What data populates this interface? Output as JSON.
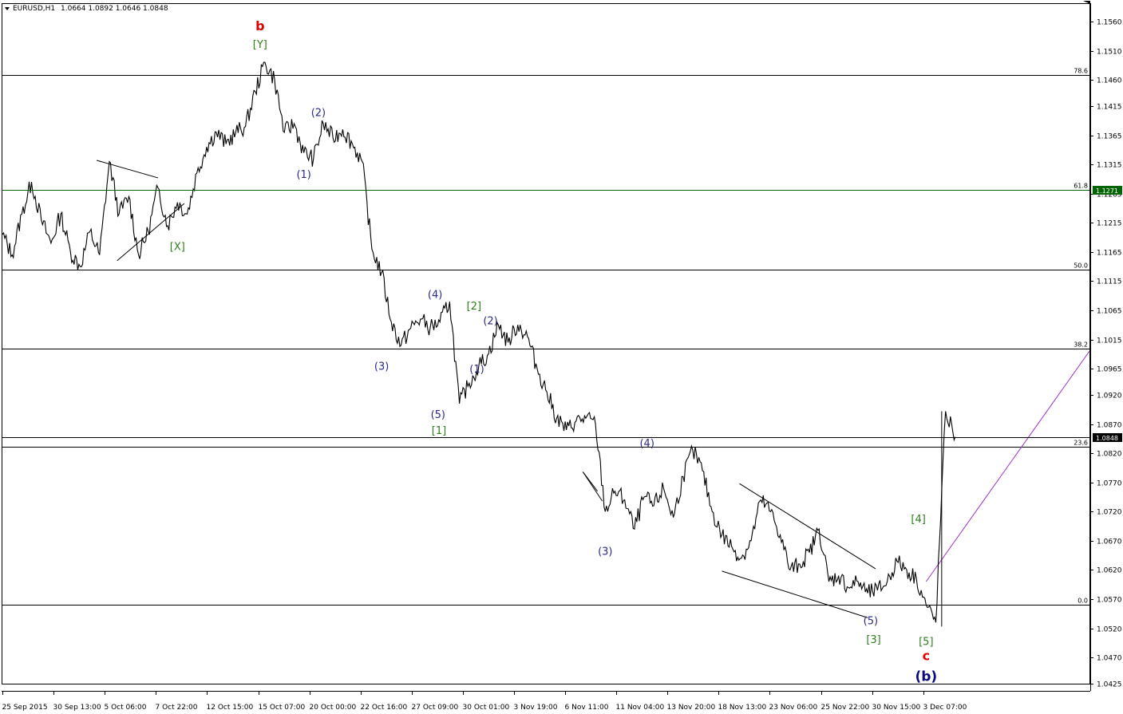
{
  "window": {
    "title": "EURUSD,H1",
    "ohlc": "1.0664 1.0892 1.0646 1.0848"
  },
  "chart_data": {
    "type": "line",
    "symbol": "EURUSD",
    "timeframe": "H1",
    "ylim": [
      1.0425,
      1.159
    ],
    "y_ticks": [
      "1.1560",
      "1.1510",
      "1.1460",
      "1.1415",
      "1.1365",
      "1.1315",
      "1.1265",
      "1.1215",
      "1.1165",
      "1.1115",
      "1.1065",
      "1.1015",
      "1.0965",
      "1.0920",
      "1.0870",
      "1.0820",
      "1.0770",
      "1.0720",
      "1.0670",
      "1.0620",
      "1.0570",
      "1.0520",
      "1.0470",
      "1.0425"
    ],
    "x_ticks": [
      "25 Sep 2015",
      "30 Sep 13:00",
      "5 Oct 06:00",
      "7 Oct 22:00",
      "12 Oct 15:00",
      "15 Oct 07:00",
      "20 Oct 00:00",
      "22 Oct 16:00",
      "27 Oct 09:00",
      "30 Oct 01:00",
      "3 Nov 19:00",
      "6 Nov 11:00",
      "11 Nov 04:00",
      "13 Nov 20:00",
      "18 Nov 13:00",
      "23 Nov 06:00",
      "25 Nov 22:00",
      "30 Nov 15:00",
      "3 Dec 07:00"
    ],
    "price_path": [
      [
        0,
        1.1195
      ],
      [
        1,
        1.116
      ],
      [
        2,
        1.123
      ],
      [
        3,
        1.1285
      ],
      [
        4,
        1.122
      ],
      [
        5,
        1.118
      ],
      [
        6,
        1.123
      ],
      [
        7,
        1.1165
      ],
      [
        8,
        1.114
      ],
      [
        9,
        1.12
      ],
      [
        10,
        1.116
      ],
      [
        11,
        1.132
      ],
      [
        12,
        1.123
      ],
      [
        13,
        1.126
      ],
      [
        14,
        1.116
      ],
      [
        15,
        1.12
      ],
      [
        16,
        1.1275
      ],
      [
        17,
        1.121
      ],
      [
        18,
        1.125
      ],
      [
        19,
        1.123
      ],
      [
        20,
        1.13
      ],
      [
        21,
        1.1345
      ],
      [
        22,
        1.137
      ],
      [
        23,
        1.135
      ],
      [
        24,
        1.137
      ],
      [
        25,
        1.138
      ],
      [
        26,
        1.144
      ],
      [
        27,
        1.149
      ],
      [
        28,
        1.146
      ],
      [
        29,
        1.137
      ],
      [
        30,
        1.1385
      ],
      [
        31,
        1.1335
      ],
      [
        32,
        1.1325
      ],
      [
        33,
        1.1385
      ],
      [
        34,
        1.136
      ],
      [
        35,
        1.1375
      ],
      [
        36,
        1.135
      ],
      [
        37,
        1.132
      ],
      [
        38,
        1.117
      ],
      [
        39,
        1.113
      ],
      [
        40,
        1.1045
      ],
      [
        41,
        1.1005
      ],
      [
        42,
        1.1035
      ],
      [
        43,
        1.105
      ],
      [
        44,
        1.1035
      ],
      [
        45,
        1.1045
      ],
      [
        46,
        1.108
      ],
      [
        47,
        1.0905
      ],
      [
        48,
        1.094
      ],
      [
        49,
        1.097
      ],
      [
        50,
        1.099
      ],
      [
        51,
        1.104
      ],
      [
        52,
        1.101
      ],
      [
        53,
        1.104
      ],
      [
        54,
        1.102
      ],
      [
        55,
        1.0965
      ],
      [
        56,
        1.0925
      ],
      [
        57,
        1.088
      ],
      [
        58,
        1.086
      ],
      [
        59,
        1.0875
      ],
      [
        60,
        1.088
      ],
      [
        61,
        1.087
      ],
      [
        62,
        1.072
      ],
      [
        63,
        1.0755
      ],
      [
        64,
        1.074
      ],
      [
        65,
        1.069
      ],
      [
        66,
        1.0745
      ],
      [
        67,
        1.073
      ],
      [
        68,
        1.076
      ],
      [
        69,
        1.071
      ],
      [
        70,
        1.078
      ],
      [
        71,
        1.0825
      ],
      [
        72,
        1.079
      ],
      [
        73,
        1.072
      ],
      [
        74,
        1.068
      ],
      [
        75,
        1.066
      ],
      [
        76,
        1.064
      ],
      [
        77,
        1.067
      ],
      [
        78,
        1.074
      ],
      [
        79,
        1.072
      ],
      [
        80,
        1.068
      ],
      [
        81,
        1.062
      ],
      [
        82,
        1.063
      ],
      [
        83,
        1.065
      ],
      [
        84,
        1.069
      ],
      [
        85,
        1.06
      ],
      [
        86,
        1.061
      ],
      [
        87,
        1.059
      ],
      [
        88,
        1.06
      ],
      [
        89,
        1.058
      ],
      [
        90,
        1.0585
      ],
      [
        91,
        1.06
      ],
      [
        92,
        1.0635
      ],
      [
        93,
        1.062
      ],
      [
        94,
        1.0605
      ],
      [
        95,
        1.056
      ],
      [
        96,
        1.053
      ],
      [
        97,
        1.0892
      ],
      [
        98,
        1.0848
      ]
    ],
    "fib_levels": [
      {
        "label": "78.6",
        "value": 1.1468
      },
      {
        "label": "61.8",
        "value": 1.1271
      },
      {
        "label": "50.0",
        "value": 1.1135
      },
      {
        "label": "38.2",
        "value": 1.0999
      },
      {
        "label": "23.6",
        "value": 1.0831
      },
      {
        "label": "0.0",
        "value": 1.056
      }
    ],
    "current_price_tags": [
      {
        "label": "1.1271",
        "value": 1.1271,
        "color": "#006400"
      },
      {
        "label": "1.0848",
        "value": 1.0848,
        "color": "#000000"
      }
    ],
    "annotations": [
      {
        "text": "b",
        "x": 26.5,
        "y": 1.1545,
        "color": "#e00000"
      },
      {
        "text": "[Y]",
        "x": 26.5,
        "y": 1.1515,
        "color": "#2e7d1b"
      },
      {
        "text": "[X]",
        "x": 18.0,
        "y": 1.1168,
        "color": "#2e7d1b"
      },
      {
        "text": "(2)",
        "x": 32.5,
        "y": 1.1398,
        "color": "#2a2a8a"
      },
      {
        "text": "(1)",
        "x": 31.0,
        "y": 1.1292,
        "color": "#2a2a8a"
      },
      {
        "text": "(4)",
        "x": 44.5,
        "y": 1.1086,
        "color": "#2a2a8a"
      },
      {
        "text": "(3)",
        "x": 39.0,
        "y": 1.0963,
        "color": "#2a2a8a"
      },
      {
        "text": "[2]",
        "x": 48.5,
        "y": 1.1066,
        "color": "#2e7d1b"
      },
      {
        "text": "(2)",
        "x": 50.2,
        "y": 1.1041,
        "color": "#2a2a8a"
      },
      {
        "text": "(1)",
        "x": 48.8,
        "y": 1.0958,
        "color": "#2a2a8a"
      },
      {
        "text": "(5)",
        "x": 44.8,
        "y": 1.088,
        "color": "#2a2a8a"
      },
      {
        "text": "[1]",
        "x": 44.9,
        "y": 1.0853,
        "color": "#2e7d1b"
      },
      {
        "text": "(4)",
        "x": 66.3,
        "y": 1.0831,
        "color": "#2a2a8a"
      },
      {
        "text": "(3)",
        "x": 62.0,
        "y": 1.0646,
        "color": "#2a2a8a"
      },
      {
        "text": "(5)",
        "x": 89.3,
        "y": 1.0527,
        "color": "#2a2a8a"
      },
      {
        "text": "[3]",
        "x": 89.6,
        "y": 1.0495,
        "color": "#2e7d1b"
      },
      {
        "text": "[4]",
        "x": 94.2,
        "y": 1.0701,
        "color": "#2e7d1b"
      },
      {
        "text": "[5]",
        "x": 95.0,
        "y": 1.0491,
        "color": "#2e7d1b"
      },
      {
        "text": "c",
        "x": 95.0,
        "y": 1.0465,
        "color": "#e00000"
      },
      {
        "text": "(b)",
        "x": 95.0,
        "y": 1.043,
        "color": "#0a0a7a"
      }
    ],
    "trendlines": [
      {
        "from": [
          9.7,
          1.1322
        ],
        "to": [
          16.0,
          1.1292
        ],
        "color": "#000000"
      },
      {
        "from": [
          11.8,
          1.115
        ],
        "to": [
          18.7,
          1.1248
        ],
        "color": "#000000"
      },
      {
        "from": [
          59.7,
          1.0788
        ],
        "to": [
          61.7,
          1.0738
        ],
        "color": "#000000"
      },
      {
        "from": [
          59.7,
          1.0788
        ],
        "to": [
          61.2,
          1.0755
        ],
        "color": "#000000"
      },
      {
        "from": [
          75.8,
          1.0768
        ],
        "to": [
          89.8,
          1.0622
        ],
        "color": "#000000"
      },
      {
        "from": [
          74.0,
          1.0618
        ],
        "to": [
          89.0,
          1.0538
        ],
        "color": "#000000"
      },
      {
        "from": [
          95.0,
          1.06
        ],
        "to": [
          111.8,
          1.0995
        ],
        "color": "#9b30c8"
      }
    ],
    "x_range": [
      0,
      111.8
    ]
  }
}
